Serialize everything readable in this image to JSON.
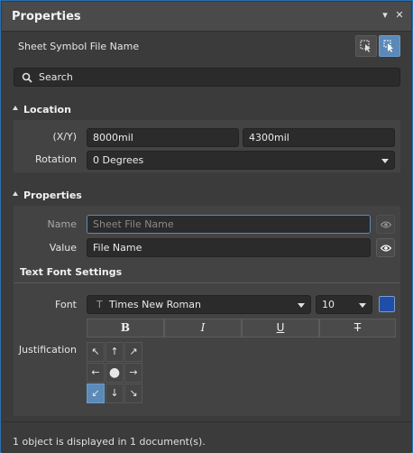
{
  "panel": {
    "title": "Properties",
    "pin_icon": "chevron-down-icon",
    "close_icon": "close-icon"
  },
  "header": {
    "object_label": "Sheet Symbol File Name"
  },
  "search": {
    "placeholder": "Search"
  },
  "location": {
    "title": "Location",
    "xy_label": "(X/Y)",
    "x_value": "8000mil",
    "y_value": "4300mil",
    "rotation_label": "Rotation",
    "rotation_value": "0 Degrees"
  },
  "properties": {
    "title": "Properties",
    "name_label": "Name",
    "name_placeholder": "Sheet File Name",
    "value_label": "Value",
    "value_value": "File Name",
    "text_font_settings": "Text Font Settings",
    "font_label": "Font",
    "font_icon": "T",
    "font_value": "Times New Roman",
    "size_value": "10",
    "font_color": "#1f4ea8",
    "format_buttons": [
      "B",
      "I",
      "U",
      "T"
    ],
    "justification_label": "Justification",
    "justification_glyphs": [
      "↖",
      "↑",
      "↗",
      "←",
      "●",
      "→",
      "↙",
      "↓",
      "↘"
    ],
    "justification_selected": 6
  },
  "footer": {
    "status": "1 object is displayed in 1 document(s)."
  },
  "colors": {
    "accent": "#5b8ab8",
    "border": "#2a6fb0"
  }
}
